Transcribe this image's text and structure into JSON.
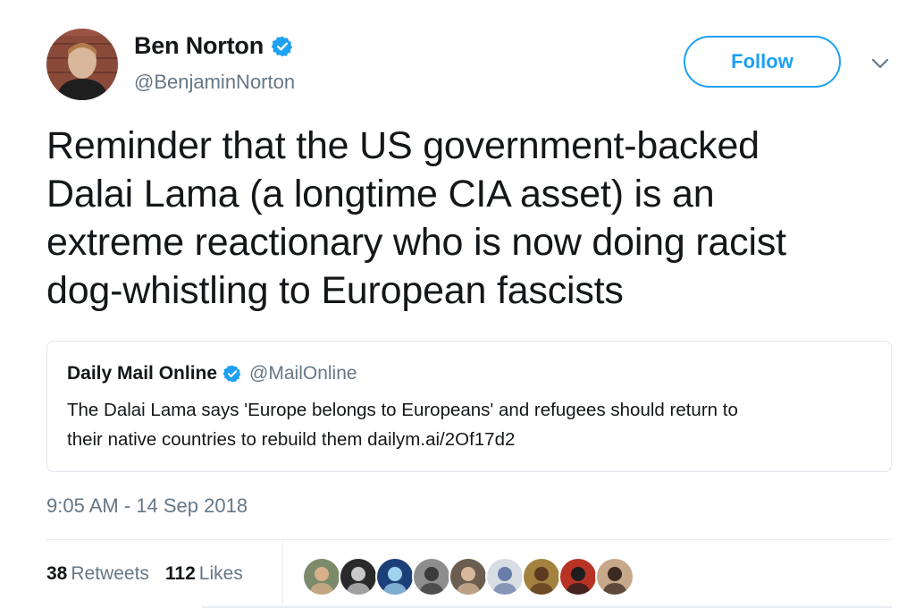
{
  "author": {
    "name": "Ben Norton",
    "handle": "@BenjaminNorton",
    "verified": true
  },
  "follow_button": {
    "label": "Follow"
  },
  "tweet": {
    "text": "Reminder that the US government-backed\nDalai Lama (a longtime CIA asset) is an\nextreme reactionary who is now doing racist\ndog-whistling to European fascists",
    "timestamp": "9:05 AM - 14 Sep 2018"
  },
  "quoted_tweet": {
    "name": "Daily Mail Online",
    "verified": true,
    "handle": "@MailOnline",
    "text": "The Dalai Lama says 'Europe belongs to Europeans' and refugees should return to\ntheir native countries to rebuild them dailym.ai/2Of17d2"
  },
  "stats": {
    "retweets_count": "38",
    "retweets_label": "Retweets",
    "likes_count": "112",
    "likes_label": "Likes"
  },
  "liker_avatars": [
    {
      "icon": "user-avatar",
      "bg": "#7b8a6a",
      "skin": "#d9b08c"
    },
    {
      "icon": "user-avatar",
      "bg": "#2a2a2a",
      "skin": "#c9c9c9"
    },
    {
      "icon": "user-avatar",
      "bg": "#1c3f7a",
      "skin": "#9fd3f0"
    },
    {
      "icon": "user-avatar",
      "bg": "#8d8d8d",
      "skin": "#3a3a3a"
    },
    {
      "icon": "user-avatar",
      "bg": "#6b5d4f",
      "skin": "#d7b89a"
    },
    {
      "icon": "user-avatar",
      "bg": "#d8dde3",
      "skin": "#6a7da8"
    },
    {
      "icon": "user-avatar",
      "bg": "#a3813f",
      "skin": "#5b3a1e"
    },
    {
      "icon": "user-avatar",
      "bg": "#b83226",
      "skin": "#1e1e1e"
    },
    {
      "icon": "user-avatar",
      "bg": "#c7a88a",
      "skin": "#3b2a1f"
    }
  ],
  "colors": {
    "accent": "#1da1f2",
    "text_primary": "#14171a",
    "text_secondary": "#657786",
    "border": "#e1e8ed"
  }
}
